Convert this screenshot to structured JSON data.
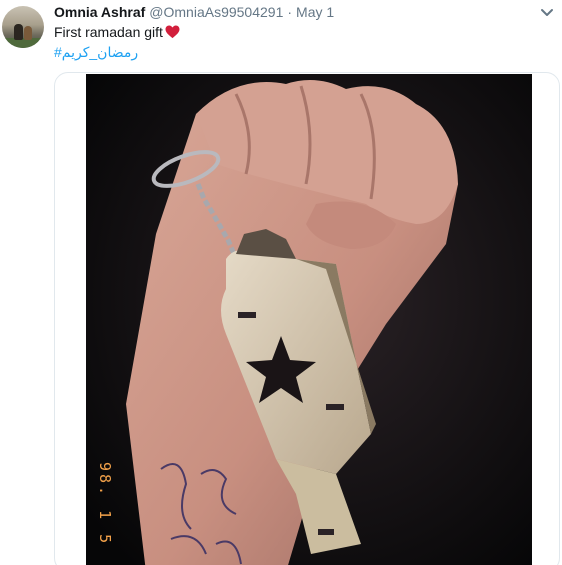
{
  "tweet": {
    "author_name": "Omnia Ashraf",
    "author_handle": "@OmniaAs99504291",
    "separator": "·",
    "date": "May 1",
    "text": "First ramadan gift",
    "hashtag": "#رمضان_كريم",
    "photo_date_stamp": "98. 1 5",
    "icons": {
      "menu": "chevron-down-icon",
      "emoji": "red-heart-emoji"
    }
  },
  "colors": {
    "name": "#14171a",
    "secondary": "#657786",
    "link": "#1da1f2",
    "heart": "#d21f3c",
    "border": "#e1e8ed",
    "date_stamp": "#f2a14a"
  }
}
